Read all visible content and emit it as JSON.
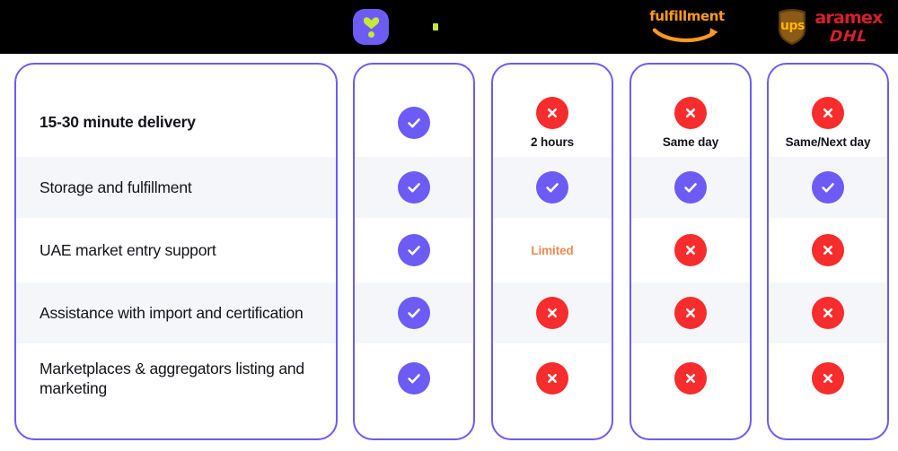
{
  "header": {
    "logos": [
      {
        "name": "brand-logo-mark",
        "type": "squircle",
        "label": "brand-squircle-logo",
        "bg": "#6c5bf5",
        "fg": "#c6e83b"
      },
      {
        "name": "secondary-mark",
        "type": "dot",
        "label": "green-dot-mark",
        "fg": "#c6e83b"
      },
      {
        "name": "amazon-fulfillment-logo",
        "type": "amazon",
        "label": "fulfillment",
        "fg": "#ff9a1e"
      },
      {
        "name": "courier-logos",
        "type": "couriers",
        "ups": "ups",
        "aramex": "aramex",
        "dhl": "DHL",
        "fg": "#d6202a"
      }
    ]
  },
  "colors": {
    "accent": "#6c5bf5",
    "negative": "#f72c2c",
    "warning": "#f08a4f",
    "stripe": "#f5f6f9",
    "text": "#13131a",
    "header_band": "#000000"
  },
  "table": {
    "columns": [
      {
        "key": "feature",
        "name": "feature-column"
      },
      {
        "key": "brand",
        "name": "brand-column"
      },
      {
        "key": "provider2",
        "name": "provider-2-column"
      },
      {
        "key": "provider3",
        "name": "provider-3-column"
      },
      {
        "key": "provider4",
        "name": "provider-4-column"
      }
    ],
    "rows": [
      {
        "feature": "15-30 minute delivery",
        "emphasis": true,
        "striped": false,
        "cells": [
          {
            "status": "yes",
            "note": ""
          },
          {
            "status": "no",
            "note": "2 hours"
          },
          {
            "status": "no",
            "note": "Same day"
          },
          {
            "status": "no",
            "note": "Same/Next day"
          }
        ]
      },
      {
        "feature": "Storage and fulfillment",
        "emphasis": false,
        "striped": true,
        "cells": [
          {
            "status": "yes",
            "note": ""
          },
          {
            "status": "yes",
            "note": ""
          },
          {
            "status": "yes",
            "note": ""
          },
          {
            "status": "yes",
            "note": ""
          }
        ]
      },
      {
        "feature": "UAE market entry support",
        "emphasis": false,
        "striped": false,
        "cells": [
          {
            "status": "yes",
            "note": ""
          },
          {
            "status": "limited",
            "note": "Limited"
          },
          {
            "status": "no",
            "note": ""
          },
          {
            "status": "no",
            "note": ""
          }
        ]
      },
      {
        "feature": "Assistance with import and certification",
        "emphasis": false,
        "striped": true,
        "cells": [
          {
            "status": "yes",
            "note": ""
          },
          {
            "status": "no",
            "note": ""
          },
          {
            "status": "no",
            "note": ""
          },
          {
            "status": "no",
            "note": ""
          }
        ]
      },
      {
        "feature": "Marketplaces & aggregators listing and marketing",
        "emphasis": false,
        "striped": false,
        "cells": [
          {
            "status": "yes",
            "note": ""
          },
          {
            "status": "no",
            "note": ""
          },
          {
            "status": "no",
            "note": ""
          },
          {
            "status": "no",
            "note": ""
          }
        ]
      }
    ]
  }
}
